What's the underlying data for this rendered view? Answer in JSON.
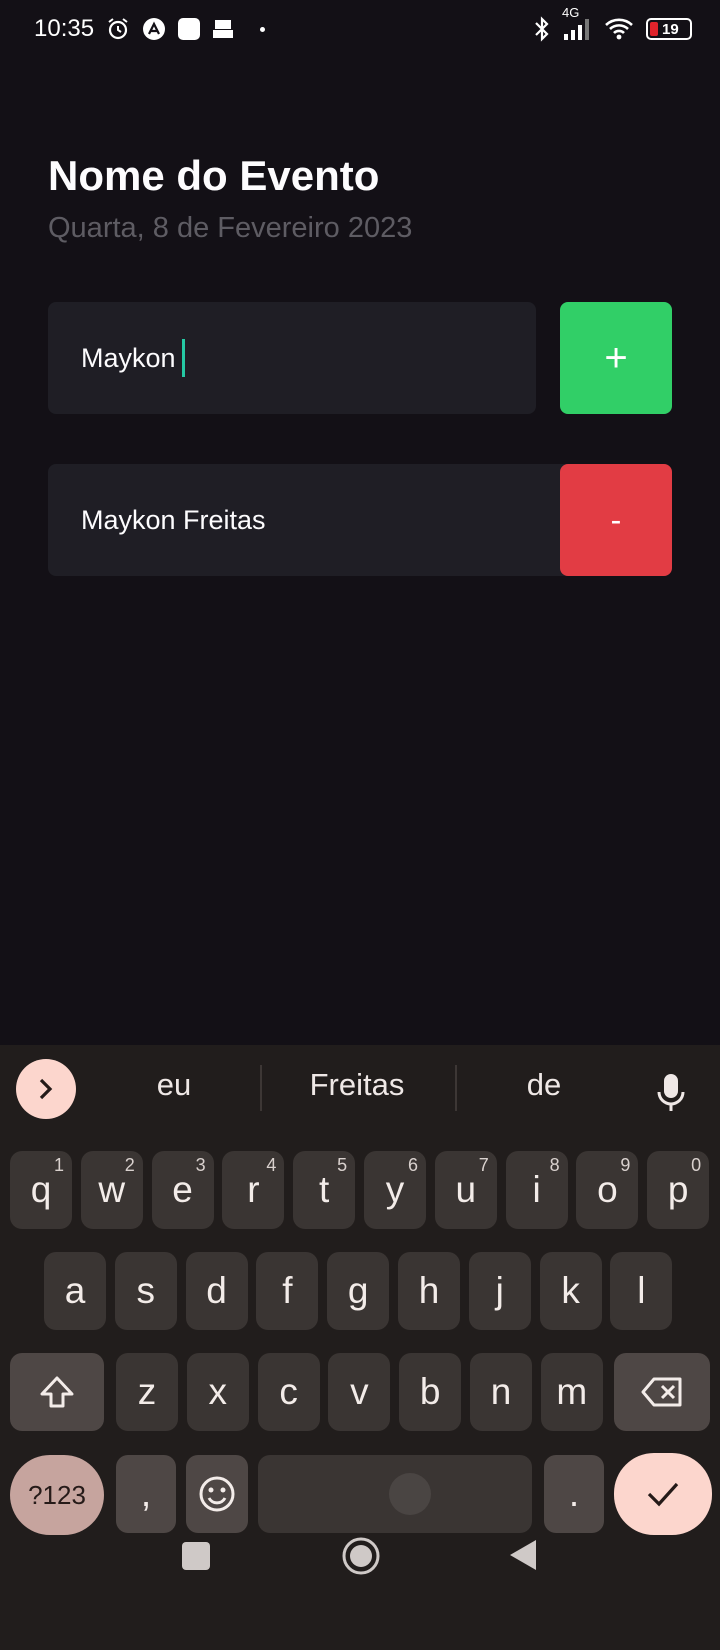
{
  "status_bar": {
    "time": "10:35",
    "network": "4G",
    "battery": "19"
  },
  "header": {
    "title": "Nome do Evento",
    "date": "Quarta, 8 de Fevereiro 2023"
  },
  "input": {
    "value": "Maykon",
    "add_label": "+"
  },
  "participants": [
    {
      "name": "Maykon Freitas",
      "remove_label": "-"
    }
  ],
  "keyboard": {
    "suggestions": [
      "eu",
      "Freitas",
      "de"
    ],
    "row1": [
      {
        "key": "q",
        "num": "1"
      },
      {
        "key": "w",
        "num": "2"
      },
      {
        "key": "e",
        "num": "3"
      },
      {
        "key": "r",
        "num": "4"
      },
      {
        "key": "t",
        "num": "5"
      },
      {
        "key": "y",
        "num": "6"
      },
      {
        "key": "u",
        "num": "7"
      },
      {
        "key": "i",
        "num": "8"
      },
      {
        "key": "o",
        "num": "9"
      },
      {
        "key": "p",
        "num": "0"
      }
    ],
    "row2": [
      "a",
      "s",
      "d",
      "f",
      "g",
      "h",
      "j",
      "k",
      "l"
    ],
    "row3": [
      "z",
      "x",
      "c",
      "v",
      "b",
      "n",
      "m"
    ],
    "symbols_label": "?123",
    "comma": ",",
    "period": "."
  },
  "colors": {
    "background": "#131016",
    "add": "#31cf67",
    "remove": "#e23c44",
    "caret": "#25c9a4"
  }
}
